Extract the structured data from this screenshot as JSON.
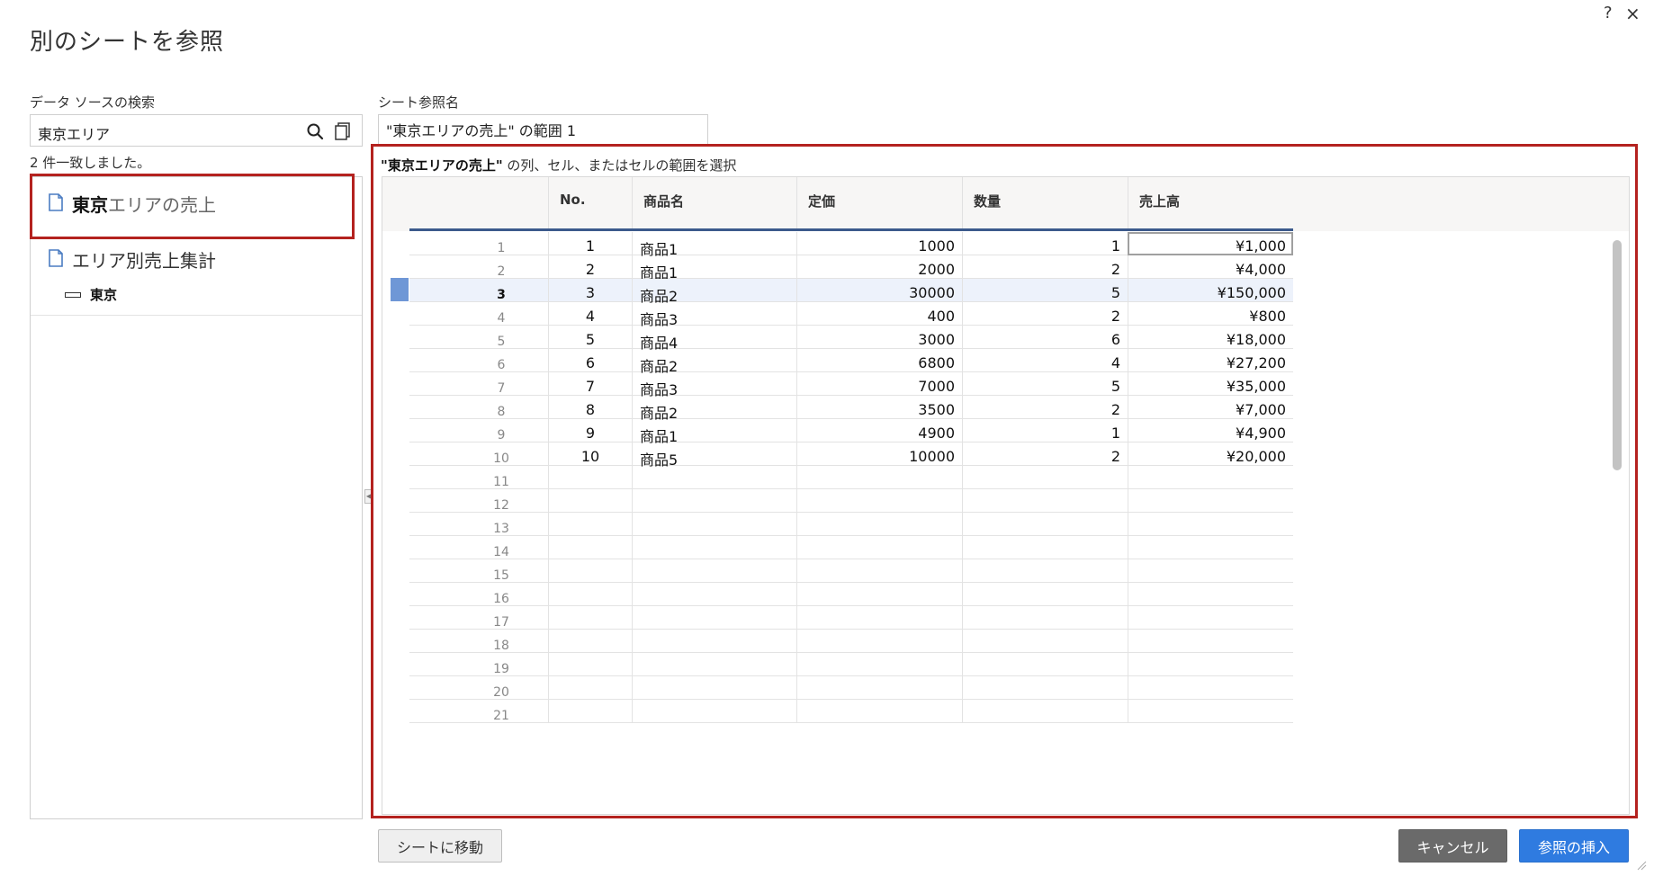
{
  "dialog": {
    "title": "別のシートを参照",
    "help_label": "?",
    "close_label": "×"
  },
  "search": {
    "label": "データ ソースの検索",
    "value": "東京エリア",
    "match_count": "2 件一致しました。"
  },
  "sources": [
    {
      "highlight": "東京",
      "rest": "エリアの売上"
    },
    {
      "label": "エリア別売上集計",
      "sub_items": [
        "東京"
      ]
    }
  ],
  "reference_name": {
    "label": "シート参照名",
    "value": "\"東京エリアの売上\" の範囲 1"
  },
  "instruction": {
    "sheet_name": "\"東京エリアの売上\"",
    "rest": " の列、セル、またはセルの範囲を選択"
  },
  "grid": {
    "columns": [
      "No.",
      "商品名",
      "定価",
      "数量",
      "売上高"
    ],
    "selected_row": 3,
    "active_cell": {
      "row": 1,
      "column": "売上高"
    },
    "rows": [
      [
        "1",
        "1",
        "商品1",
        "1000",
        "1",
        "¥1,000"
      ],
      [
        "2",
        "2",
        "商品1",
        "2000",
        "2",
        "¥4,000"
      ],
      [
        "3",
        "3",
        "商品2",
        "30000",
        "5",
        "¥150,000"
      ],
      [
        "4",
        "4",
        "商品3",
        "400",
        "2",
        "¥800"
      ],
      [
        "5",
        "5",
        "商品4",
        "3000",
        "6",
        "¥18,000"
      ],
      [
        "6",
        "6",
        "商品2",
        "6800",
        "4",
        "¥27,200"
      ],
      [
        "7",
        "7",
        "商品3",
        "7000",
        "5",
        "¥35,000"
      ],
      [
        "8",
        "8",
        "商品2",
        "3500",
        "2",
        "¥7,000"
      ],
      [
        "9",
        "9",
        "商品1",
        "4900",
        "1",
        "¥4,900"
      ],
      [
        "10",
        "10",
        "商品5",
        "10000",
        "2",
        "¥20,000"
      ],
      [
        "11",
        "",
        "",
        "",
        "",
        ""
      ],
      [
        "12",
        "",
        "",
        "",
        "",
        ""
      ],
      [
        "13",
        "",
        "",
        "",
        "",
        ""
      ],
      [
        "14",
        "",
        "",
        "",
        "",
        ""
      ],
      [
        "15",
        "",
        "",
        "",
        "",
        ""
      ],
      [
        "16",
        "",
        "",
        "",
        "",
        ""
      ],
      [
        "17",
        "",
        "",
        "",
        "",
        ""
      ],
      [
        "18",
        "",
        "",
        "",
        "",
        ""
      ],
      [
        "19",
        "",
        "",
        "",
        "",
        ""
      ],
      [
        "20",
        "",
        "",
        "",
        "",
        ""
      ],
      [
        "21",
        "",
        "",
        "",
        "",
        ""
      ]
    ]
  },
  "buttons": {
    "goto_sheet": "シートに移動",
    "cancel": "キャンセル",
    "insert_reference": "参照の挿入"
  },
  "colors": {
    "highlight_border": "#b4221f",
    "primary_button": "#2f7be0",
    "cancel_button": "#6a6a6a",
    "row_selector": "#6f97d6",
    "header_underline": "#3c5a8c"
  }
}
